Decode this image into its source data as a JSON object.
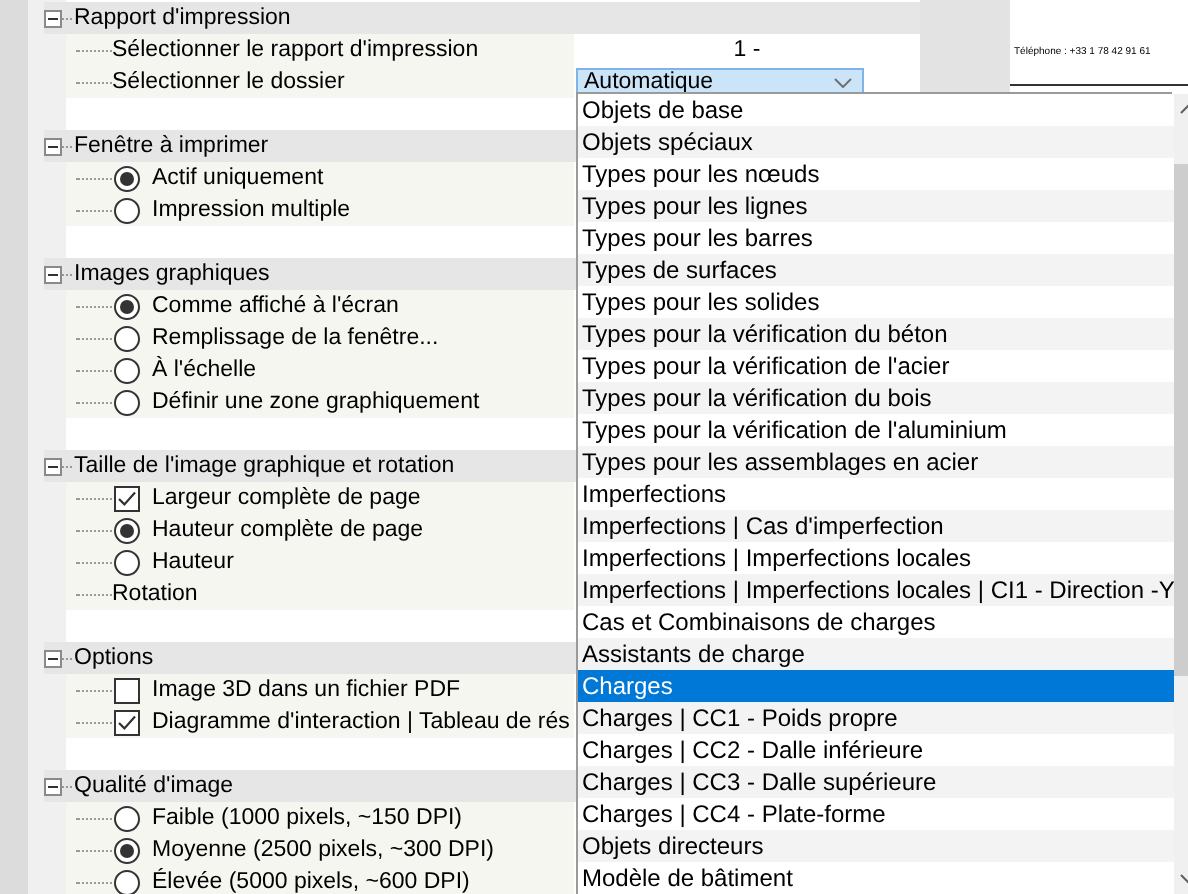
{
  "sections": [
    {
      "title": "Rapport d'impression",
      "expanded": true,
      "items": [
        {
          "kind": "text",
          "label": "Sélectionner le rapport d'impression",
          "value": "1 -"
        },
        {
          "kind": "text",
          "label": "Sélectionner le dossier",
          "combo": "Automatique"
        }
      ]
    },
    {
      "title": "Fenêtre à imprimer",
      "expanded": true,
      "items": [
        {
          "kind": "radio",
          "label": "Actif uniquement",
          "selected": true
        },
        {
          "kind": "radio",
          "label": "Impression multiple",
          "selected": false
        }
      ]
    },
    {
      "title": "Images graphiques",
      "expanded": true,
      "items": [
        {
          "kind": "radio",
          "label": "Comme affiché à l'écran",
          "selected": true
        },
        {
          "kind": "radio",
          "label": "Remplissage de la fenêtre...",
          "selected": false
        },
        {
          "kind": "radio",
          "label": "À l'échelle",
          "selected": false
        },
        {
          "kind": "radio",
          "label": "Définir une zone graphiquement",
          "selected": false
        }
      ]
    },
    {
      "title": "Taille de l'image graphique et rotation",
      "expanded": true,
      "items": [
        {
          "kind": "checkbox",
          "label": "Largeur complète de page",
          "checked": true
        },
        {
          "kind": "radio",
          "label": "Hauteur complète de page",
          "selected": true
        },
        {
          "kind": "radio",
          "label": "Hauteur",
          "selected": false
        },
        {
          "kind": "text",
          "label": "Rotation"
        }
      ]
    },
    {
      "title": "Options",
      "expanded": true,
      "items": [
        {
          "kind": "checkbox",
          "label": "Image 3D dans un fichier PDF",
          "checked": false
        },
        {
          "kind": "checkbox",
          "label": "Diagramme d'interaction | Tableau de rés",
          "checked": true
        }
      ]
    },
    {
      "title": "Qualité d'image",
      "expanded": true,
      "items": [
        {
          "kind": "radio",
          "label": "Faible (1000 pixels, ~150 DPI)",
          "selected": false
        },
        {
          "kind": "radio",
          "label": "Moyenne (2500 pixels, ~300 DPI)",
          "selected": true
        },
        {
          "kind": "radio",
          "label": "Élevée (5000 pixels, ~600 DPI)",
          "selected": false
        }
      ]
    }
  ],
  "preview": {
    "phone": "Téléphone : +33 1 78 42 91 61"
  },
  "dropdown": {
    "options": [
      {
        "label": "Objets de base",
        "selected": false
      },
      {
        "label": "Objets spéciaux",
        "selected": false
      },
      {
        "label": "Types pour les nœuds",
        "selected": false
      },
      {
        "label": "Types pour les lignes",
        "selected": false
      },
      {
        "label": "Types pour les barres",
        "selected": false
      },
      {
        "label": "Types de surfaces",
        "selected": false
      },
      {
        "label": "Types pour les solides",
        "selected": false
      },
      {
        "label": "Types pour la vérification du béton",
        "selected": false
      },
      {
        "label": "Types pour la vérification de l'acier",
        "selected": false
      },
      {
        "label": "Types pour la vérification du bois",
        "selected": false
      },
      {
        "label": "Types pour la vérification de l'aluminium",
        "selected": false
      },
      {
        "label": "Types pour les assemblages en acier",
        "selected": false
      },
      {
        "label": "Imperfections",
        "selected": false
      },
      {
        "label": "Imperfections | Cas d'imperfection",
        "selected": false
      },
      {
        "label": "Imperfections | Imperfections locales",
        "selected": false
      },
      {
        "label": "Imperfections | Imperfections locales | CI1 - Direction -Y",
        "selected": false
      },
      {
        "label": "Cas et Combinaisons de charges",
        "selected": false
      },
      {
        "label": "Assistants de charge",
        "selected": false
      },
      {
        "label": "Charges",
        "selected": true
      },
      {
        "label": "Charges | CC1 - Poids propre",
        "selected": false
      },
      {
        "label": "Charges | CC2 - Dalle inférieure",
        "selected": false
      },
      {
        "label": "Charges | CC3 - Dalle supérieure",
        "selected": false
      },
      {
        "label": "Charges | CC4 - Plate-forme",
        "selected": false
      },
      {
        "label": "Objets directeurs",
        "selected": false
      },
      {
        "label": "Modèle de bâtiment",
        "selected": false
      }
    ]
  }
}
